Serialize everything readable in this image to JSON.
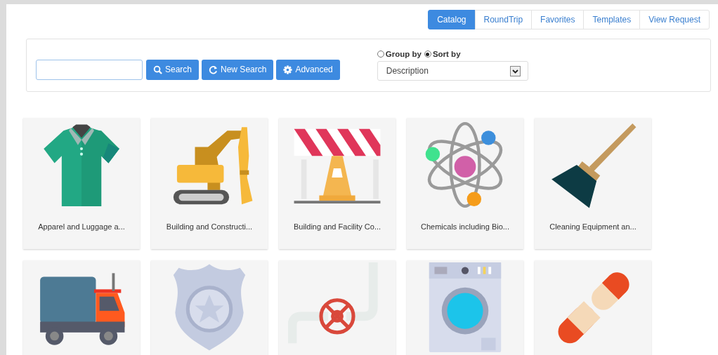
{
  "tabs": [
    {
      "label": "Catalog",
      "selected": true
    },
    {
      "label": "RoundTrip",
      "selected": false
    },
    {
      "label": "Favorites",
      "selected": false
    },
    {
      "label": "Templates",
      "selected": false
    },
    {
      "label": "View Request",
      "selected": false
    }
  ],
  "search": {
    "buttons": [
      {
        "kind": "search",
        "label": "Search"
      },
      {
        "kind": "refresh",
        "label": "New Search"
      },
      {
        "kind": "gear",
        "label": "Advanced"
      }
    ],
    "options": [
      {
        "label": "Group by",
        "selected": false
      },
      {
        "label": "Sort by",
        "selected": true
      }
    ],
    "sort_value": "Description"
  },
  "categories": [
    {
      "kind": "shirt",
      "label": "Apparel and Luggage a..."
    },
    {
      "kind": "excavator",
      "label": "Building and Constructi..."
    },
    {
      "kind": "barrier",
      "label": "Building and Facility Co..."
    },
    {
      "kind": "atom",
      "label": "Chemicals including Bio..."
    },
    {
      "kind": "broom",
      "label": "Cleaning Equipment an..."
    },
    {
      "kind": "truck"
    },
    {
      "kind": "badge"
    },
    {
      "kind": "valve"
    },
    {
      "kind": "washer"
    },
    {
      "kind": "pills"
    }
  ]
}
